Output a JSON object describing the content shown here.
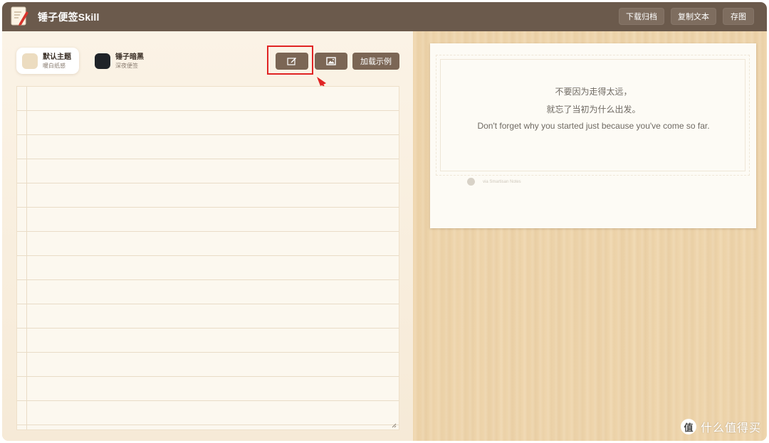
{
  "header": {
    "title": "锤子便签Skill",
    "buttons": {
      "download": "下载归档",
      "copy": "复制文本",
      "save_image": "存图"
    }
  },
  "themes": [
    {
      "name": "默认主题",
      "sub": "暖白纸感",
      "swatch": "#ecdcc0",
      "active": true
    },
    {
      "name": "锤子暗黑",
      "sub": "深夜便签",
      "swatch": "#1f2328",
      "active": false
    }
  ],
  "toolbar": {
    "example_label": "加载示例"
  },
  "note": {
    "lines": [
      "不要因为走得太远，",
      "就忘了当初为什么出发。",
      "Don't forget why you started just because you've come so far."
    ],
    "watermark": "via Smartisan Notes"
  },
  "corner": {
    "badge": "值",
    "text": "什么值得买"
  },
  "colors": {
    "header": "#6b5a4c",
    "button": "#7b6655",
    "highlight": "#e02424"
  }
}
